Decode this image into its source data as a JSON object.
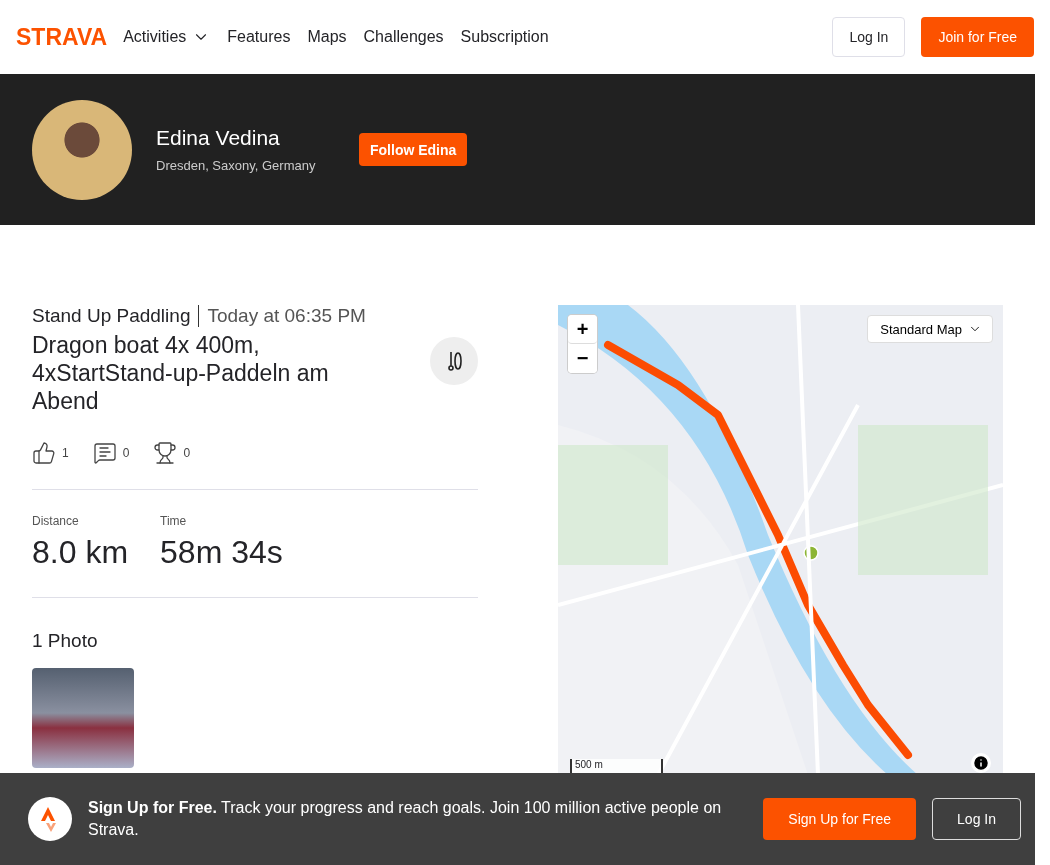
{
  "nav": {
    "logo": "STRAVA",
    "links": [
      {
        "label": "Activities",
        "dropdown": true
      },
      {
        "label": "Features",
        "dropdown": false
      },
      {
        "label": "Maps",
        "dropdown": false
      },
      {
        "label": "Challenges",
        "dropdown": false
      },
      {
        "label": "Subscription",
        "dropdown": false
      }
    ],
    "login": "Log In",
    "join": "Join for Free"
  },
  "profile": {
    "name": "Edina Vedina",
    "location": "Dresden, Saxony, Germany",
    "follow": "Follow Edina"
  },
  "activity": {
    "sport": "Stand Up Paddling",
    "time": "Today at 06:35 PM",
    "title": "Dragon boat 4x 400m, 4xStartStand-up-Paddeln am Abend",
    "reactions": [
      {
        "kind": "kudos",
        "count": "1"
      },
      {
        "kind": "comments",
        "count": "0"
      },
      {
        "kind": "achievements",
        "count": "0"
      }
    ],
    "stats": [
      {
        "label": "Distance",
        "value": "8.0 km"
      },
      {
        "label": "Time",
        "value": "58m 34s"
      }
    ],
    "photos_heading": "1 Photo"
  },
  "map": {
    "style": "Standard Map",
    "zoom_in": "+",
    "zoom_out": "−",
    "scale": "500 m"
  },
  "banner": {
    "lead": "Sign Up for Free.",
    "text": "Track your progress and reach goals. Join 100 million active people on Strava.",
    "signup": "Sign Up for Free",
    "login": "Log In"
  }
}
